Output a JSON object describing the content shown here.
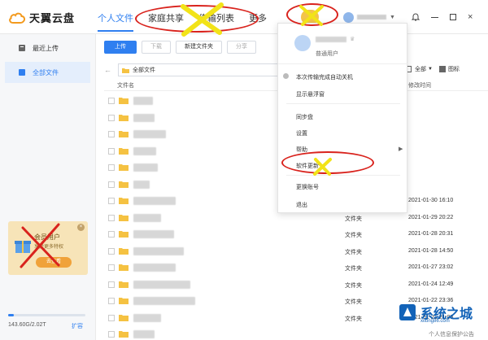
{
  "app": {
    "title": "天翼云盘"
  },
  "nav": [
    {
      "label": "个人文件"
    },
    {
      "label": "家庭共享"
    },
    {
      "label": "传输列表"
    },
    {
      "label": "更多"
    }
  ],
  "sidebar": {
    "items": [
      {
        "label": "最近上传"
      },
      {
        "label": "全部文件"
      }
    ]
  },
  "promo": {
    "title": "会员用户",
    "subtitle": "享受更多特权",
    "button": "去查看"
  },
  "storage": {
    "used_label": "143.60G/2.02T",
    "used_fraction": 0.07,
    "expand_label": "扩容"
  },
  "toolbar": {
    "upload": "上传",
    "download": "下载",
    "new_folder": "新建文件夹",
    "share": "分享"
  },
  "path": {
    "current": "全部文件"
  },
  "view": {
    "all_label": "全部",
    "icon_label": "图标"
  },
  "table": {
    "name_header": "文件名",
    "date_header": "修改时间",
    "rows": [
      {
        "type": "",
        "date": ""
      },
      {
        "type": "",
        "date": ""
      },
      {
        "type": "",
        "date": ""
      },
      {
        "type": "",
        "date": ""
      },
      {
        "type": "",
        "date": ""
      },
      {
        "type": "",
        "date": ""
      },
      {
        "type": "文件夹",
        "date": "2021-01-30 16:10"
      },
      {
        "type": "文件夹",
        "date": "2021-01-29 20:22"
      },
      {
        "type": "文件夹",
        "date": "2021-01-28 20:31"
      },
      {
        "type": "文件夹",
        "date": "2021-01-28 14:50"
      },
      {
        "type": "文件夹",
        "date": "2021-01-27 23:02"
      },
      {
        "type": "文件夹",
        "date": "2021-01-24 12:49"
      },
      {
        "type": "文件夹",
        "date": "2021-01-22 23:36"
      },
      {
        "type": "文件夹",
        "date": "2021-01-21 21:03"
      },
      {
        "type": "",
        "date": ""
      }
    ]
  },
  "menu": {
    "user_level": "普通用户",
    "items": [
      {
        "label": "本次传输完成自动关机"
      },
      {
        "label": "显示悬浮窗"
      },
      {
        "label": "同步盘"
      },
      {
        "label": "设置"
      },
      {
        "label": "帮助"
      },
      {
        "label": "软件更新"
      },
      {
        "label": "更换账号"
      },
      {
        "label": "退出"
      }
    ]
  },
  "watermark": {
    "title": "系统之城",
    "url": "xitong86.com"
  },
  "footer": {
    "privacy": "个人信息保护公告"
  },
  "colors": {
    "accent": "#2f7ff0",
    "annotation": "#d9231d",
    "folder": "#f5c242"
  }
}
